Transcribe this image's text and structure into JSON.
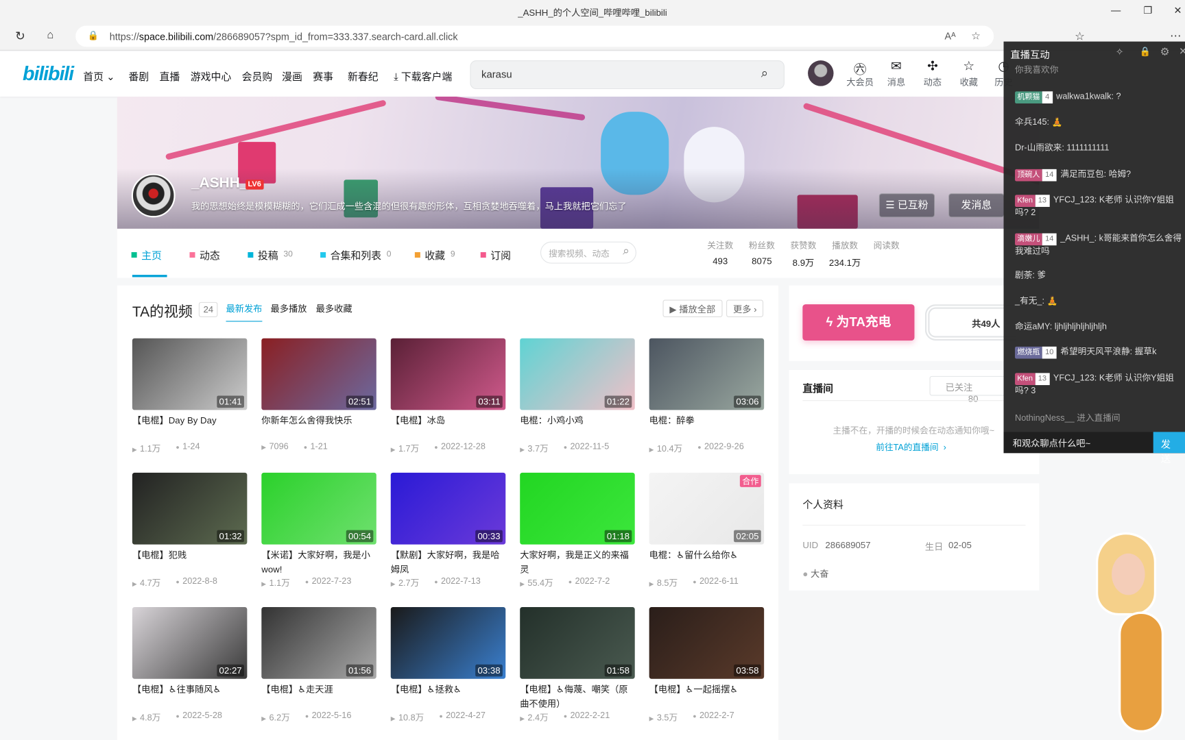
{
  "browser": {
    "tab_title": "_ASHH_的个人空间_哔哩哔哩_bilibili",
    "url_prefix": "https://",
    "url_host": "space.bilibili.com",
    "url_rest": "/286689057?spm_id_from=333.337.search-card.all.click"
  },
  "header": {
    "logo": "bilibili",
    "nav": [
      "首页",
      "番剧",
      "直播",
      "游戏中心",
      "会员购",
      "漫画",
      "赛事",
      "新春纪",
      "下载客户端"
    ],
    "search_value": "karasu",
    "icons": [
      {
        "label": "大会员",
        "icon": "vip-icon"
      },
      {
        "label": "消息",
        "icon": "mail-icon"
      },
      {
        "label": "动态",
        "icon": "pinwheel-icon"
      },
      {
        "label": "收藏",
        "icon": "star-icon"
      },
      {
        "label": "历史",
        "icon": "clock-icon"
      }
    ]
  },
  "profile": {
    "name": "_ASHH_",
    "level": "LV6",
    "sign": "我的思想始终是模模糊糊的，它们汇成一些含混的但很有趣的形体，互相贪婪地吞噬着，马上我就把它们忘了",
    "follow_btn": "已互粉",
    "message_btn": "发消息"
  },
  "tabs": [
    {
      "label": "主页",
      "count": "",
      "icon": "home-icon",
      "color": "#00c091"
    },
    {
      "label": "动态",
      "count": "",
      "icon": "dynamic-icon",
      "color": "#fb7299"
    },
    {
      "label": "投稿",
      "count": "30",
      "icon": "upload-icon",
      "color": "#02b5da"
    },
    {
      "label": "合集和列表",
      "count": "0",
      "icon": "collection-icon",
      "color": "#23c9ed"
    },
    {
      "label": "收藏",
      "count": "9",
      "icon": "favorite-icon",
      "color": "#f3a034"
    },
    {
      "label": "订阅",
      "count": "",
      "icon": "subscribe-icon",
      "color": "#f45a8d"
    }
  ],
  "tab_search_placeholder": "搜索视频、动态",
  "stats": [
    {
      "label": "关注数",
      "value": "493"
    },
    {
      "label": "粉丝数",
      "value": "8075"
    },
    {
      "label": "获赞数",
      "value": "8.9万"
    },
    {
      "label": "播放数",
      "value": "234.1万"
    },
    {
      "label": "阅读数",
      "value": ""
    }
  ],
  "videos_section": {
    "title": "TA的视频",
    "count": "24",
    "sorts": [
      "最新发布",
      "最多播放",
      "最多收藏"
    ],
    "play_all": "播放全部",
    "more": "更多"
  },
  "videos": [
    {
      "title": "【电棍】Day By Day",
      "duration": "01:41",
      "views": "1.1万",
      "date": "1-24",
      "c1": "#555",
      "c2": "#ccc"
    },
    {
      "title": "你新年怎么舍得我快乐",
      "duration": "02:51",
      "views": "7096",
      "date": "1-21",
      "c1": "#8a1f22",
      "c2": "#6c6aa0"
    },
    {
      "title": "【电棍】冰岛",
      "duration": "03:11",
      "views": "1.7万",
      "date": "2022-12-28",
      "c1": "#5a2036",
      "c2": "#d05a8c"
    },
    {
      "title": "电棍：小鸡小鸡",
      "duration": "01:22",
      "views": "3.7万",
      "date": "2022-11-5",
      "c1": "#5fd3d3",
      "c2": "#f0c0c8"
    },
    {
      "title": "电棍：醉拳",
      "duration": "03:06",
      "views": "10.4万",
      "date": "2022-9-26",
      "c1": "#4c5560",
      "c2": "#9aa8a0"
    },
    {
      "title": "【电棍】犯贱",
      "duration": "01:32",
      "views": "4.7万",
      "date": "2022-8-8",
      "c1": "#222",
      "c2": "#5d6b50"
    },
    {
      "title": "【米诺】大家好啊，我是小wow!",
      "duration": "00:54",
      "views": "1.1万",
      "date": "2022-7-23",
      "c1": "#2bd12b",
      "c2": "#6fe06f"
    },
    {
      "title": "【默剧】大家好啊，我是哈姆凤",
      "duration": "00:33",
      "views": "2.7万",
      "date": "2022-7-13",
      "c1": "#2a1ad6",
      "c2": "#6b3ad9"
    },
    {
      "title": "大家好啊，我是正义的来福灵",
      "duration": "01:18",
      "views": "55.4万",
      "date": "2022-7-2",
      "c1": "#22d622",
      "c2": "#3ce63c"
    },
    {
      "title": "电棍：♿留什么给你♿",
      "duration": "02:05",
      "views": "8.5万",
      "date": "2022-6-11",
      "c1": "#f4f4f4",
      "c2": "#e8e8e8",
      "badge": "合作"
    },
    {
      "title": "【电棍】♿往事随风♿",
      "duration": "02:27",
      "views": "4.8万",
      "date": "2022-5-28",
      "c1": "#d8d4d8",
      "c2": "#3a3a3a"
    },
    {
      "title": "【电棍】♿走天涯",
      "duration": "01:56",
      "views": "6.2万",
      "date": "2022-5-16",
      "c1": "#333",
      "c2": "#aaa"
    },
    {
      "title": "【电棍】♿拯救♿",
      "duration": "03:38",
      "views": "10.8万",
      "date": "2022-4-27",
      "c1": "#1a1a1a",
      "c2": "#3a80d0"
    },
    {
      "title": "【电棍】♿侮蔑、嘲笑（原曲不使用）",
      "duration": "01:58",
      "views": "2.4万",
      "date": "2022-2-21",
      "c1": "#23302a",
      "c2": "#4a5a50"
    },
    {
      "title": "【电棍】♿一起摇摆♿",
      "duration": "03:58",
      "views": "3.5万",
      "date": "2022-2-7",
      "c1": "#2a1e1a",
      "c2": "#5a3a2a"
    }
  ],
  "charge": {
    "button": "为TA充电",
    "total": "共49人"
  },
  "live": {
    "title": "直播间",
    "followed": "已关注",
    "follow_count": "80",
    "empty": "主播不在，开播的时候会在动态通知你哦~",
    "go": "前往TA的直播间"
  },
  "info": {
    "title": "个人资料",
    "uid_label": "UID",
    "uid": "286689057",
    "birthday_label": "生日",
    "birthday": "02-05",
    "tag": "大奋"
  },
  "chat": {
    "title": "直播互动",
    "messages": [
      {
        "medal": "",
        "lv": "",
        "text": "你我喜欢你",
        "mc": ""
      },
      {
        "medal": "机颗猫",
        "lv": "4",
        "text": "walkwa1kwalk: ?",
        "mc": "#4a9a80"
      },
      {
        "medal": "",
        "lv": "",
        "text": "伞兵145: 🧘",
        "mc": ""
      },
      {
        "medal": "",
        "lv": "",
        "text": "Dr-山雨欲来: 1111111111",
        "mc": ""
      },
      {
        "medal": "顶碗人",
        "lv": "14",
        "text": "满足而豆包: 哈姆?",
        "mc": "#c4507a"
      },
      {
        "medal": "Kfen",
        "lv": "13",
        "text": "YFCJ_123: K老师 认识你Y姐姐吗? 2",
        "mc": "#c4507a"
      },
      {
        "medal": "滴嫩儿",
        "lv": "14",
        "text": "_ASHH_: k哥能来首你怎么舍得我难过吗",
        "mc": "#c4507a"
      },
      {
        "medal": "",
        "lv": "",
        "text": "剧荼: 爹",
        "mc": ""
      },
      {
        "medal": "",
        "lv": "",
        "text": "_有无_: 🧘",
        "mc": ""
      },
      {
        "medal": "",
        "lv": "",
        "text": "命运aMY: ljhljhljhljhljhljh",
        "mc": ""
      },
      {
        "medal": "燃烧瓶",
        "lv": "10",
        "text": "希望明天风平浪静: 握草k",
        "mc": "#6a6a9a"
      },
      {
        "medal": "Kfen",
        "lv": "13",
        "text": "YFCJ_123: K老师 认识你Y姐姐吗? 3",
        "mc": "#c4507a"
      },
      {
        "medal": "",
        "lv": "",
        "text": "NothingNess__ 进入直播间",
        "mc": ""
      }
    ],
    "input_placeholder": "和观众聊点什么吧~",
    "send": "发送"
  }
}
